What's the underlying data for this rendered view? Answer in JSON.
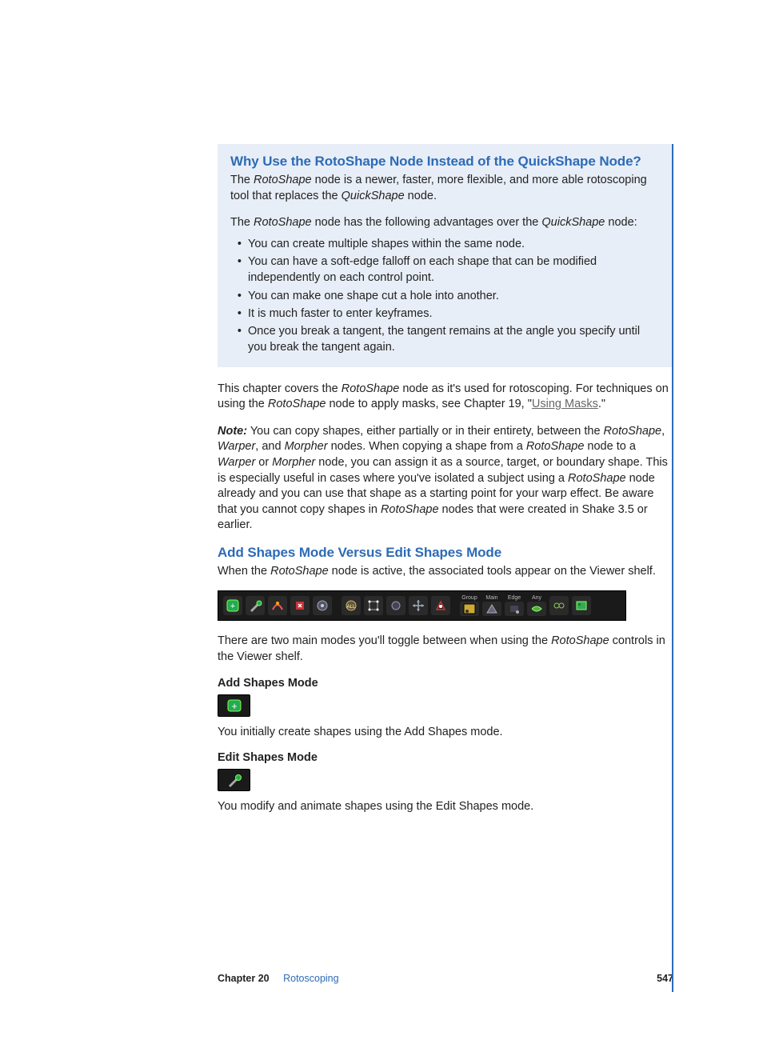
{
  "callout": {
    "heading": "Why Use the RotoShape Node Instead of the QuickShape Node?",
    "p1_a": "The ",
    "p1_b": "RotoShape",
    "p1_c": " node is a newer, faster, more flexible, and more able rotoscoping tool that replaces the ",
    "p1_d": "QuickShape",
    "p1_e": " node.",
    "p2_a": "The ",
    "p2_b": "RotoShape",
    "p2_c": " node has the following advantages over the ",
    "p2_d": "QuickShape",
    "p2_e": " node:",
    "bullets": [
      "You can create multiple shapes within the same node.",
      "You can have a soft-edge falloff on each shape that can be modified independently on each control point.",
      "You can make one shape cut a hole into another.",
      "It is much faster to enter keyframes.",
      "Once you break a tangent, the tangent remains at the angle you specify until you break the tangent again."
    ]
  },
  "body1_a": "This chapter covers the ",
  "body1_b": "RotoShape",
  "body1_c": " node as it's used for rotoscoping. For techniques on using the ",
  "body1_d": "RotoShape",
  "body1_e": " node to apply masks, see Chapter 19, \"",
  "body1_link": "Using Masks",
  "body1_f": ".\"",
  "note_label": "Note:",
  "note_a": "  You can copy shapes, either partially or in their entirety, between the ",
  "note_b": "RotoShape",
  "note_c": ", ",
  "note_d": "Warper",
  "note_e": ", and ",
  "note_f": "Morpher",
  "note_g": " nodes. When copying a shape from a ",
  "note_h": "RotoShape",
  "note_i": " node to a ",
  "note_j": "Warper",
  "note_k": " or ",
  "note_l": "Morpher",
  "note_m": " node, you can assign it as a source, target, or boundary shape. This is especially useful in cases where you've isolated a subject using a ",
  "note_n": "RotoShape",
  "note_o": " node already and you can use that shape as a starting point for your warp effect. Be aware that you cannot copy shapes in ",
  "note_p": "RotoShape",
  "note_q": " nodes that were created in Shake 3.5 or earlier.",
  "h2_2": "Add Shapes Mode Versus Edit Shapes Mode",
  "p3_a": "When the ",
  "p3_b": "RotoShape",
  "p3_c": " node is active, the associated tools appear on the Viewer shelf.",
  "p4_a": "There are two main modes you'll toggle between when using the ",
  "p4_b": "RotoShape",
  "p4_c": " controls in the Viewer shelf.",
  "sub_add": "Add Shapes Mode",
  "p5": "You initially create shapes using the Add Shapes mode.",
  "sub_edit": "Edit Shapes Mode",
  "p6": "You modify and animate shapes using the Edit Shapes mode.",
  "toolbar_labels": {
    "group": "Group",
    "main": "Main",
    "edge": "Edge",
    "any": "Any"
  },
  "footer": {
    "chapter": "Chapter 20",
    "title": "Rotoscoping",
    "page": "547"
  }
}
